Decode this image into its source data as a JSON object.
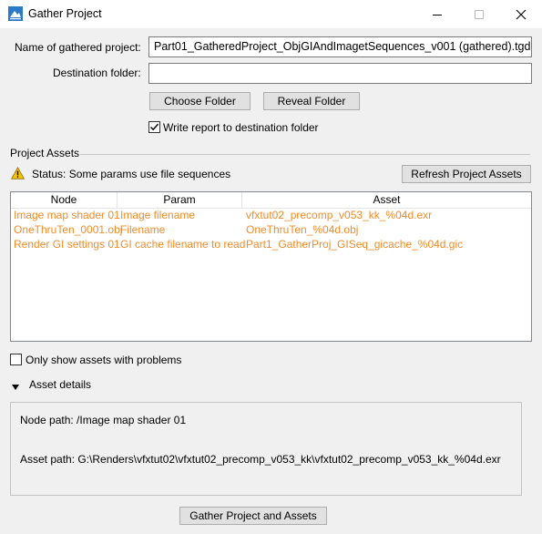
{
  "window": {
    "title": "Gather Project",
    "minimize_icon": "minimize-icon",
    "maximize_icon": "maximize-icon",
    "close_icon": "close-icon"
  },
  "form": {
    "name_label": "Name of gathered project:",
    "name_value": "Part01_GatheredProject_ObjGIAndImagetSequences_v001 (gathered).tgd",
    "dest_label": "Destination folder:",
    "dest_value": "",
    "choose_folder": "Choose Folder",
    "reveal_folder": "Reveal Folder",
    "write_report_label": "Write report to destination folder",
    "write_report_checked": true
  },
  "assets": {
    "section_title": "Project Assets",
    "status_text": "Status: Some params use file sequences",
    "refresh_button": "Refresh Project Assets",
    "columns": [
      "Node",
      "Param",
      "Asset"
    ],
    "rows": [
      {
        "node": "Image map shader 01",
        "param": "Image filename",
        "asset": "vfxtut02_precomp_v053_kk_%04d.exr"
      },
      {
        "node": "OneThruTen_0001.obj",
        "param": "Filename",
        "asset": "OneThruTen_%04d.obj"
      },
      {
        "node": "Render GI settings 01",
        "param": "GI cache filename to read",
        "asset": "Part1_GatherProj_GISeq_gicache_%04d.gic"
      }
    ],
    "row_color": "#f28c28",
    "only_problems_label": "Only show assets with problems",
    "only_problems_checked": false
  },
  "details": {
    "header": "Asset details",
    "node_path": "Node path: /Image map shader 01",
    "asset_path": "Asset path: G:\\Renders\\vfxtut02\\vfxtut02_precomp_v053_kk\\vfxtut02_precomp_v053_kk_%04d.exr"
  },
  "footer": {
    "gather_button": "Gather Project and Assets"
  }
}
